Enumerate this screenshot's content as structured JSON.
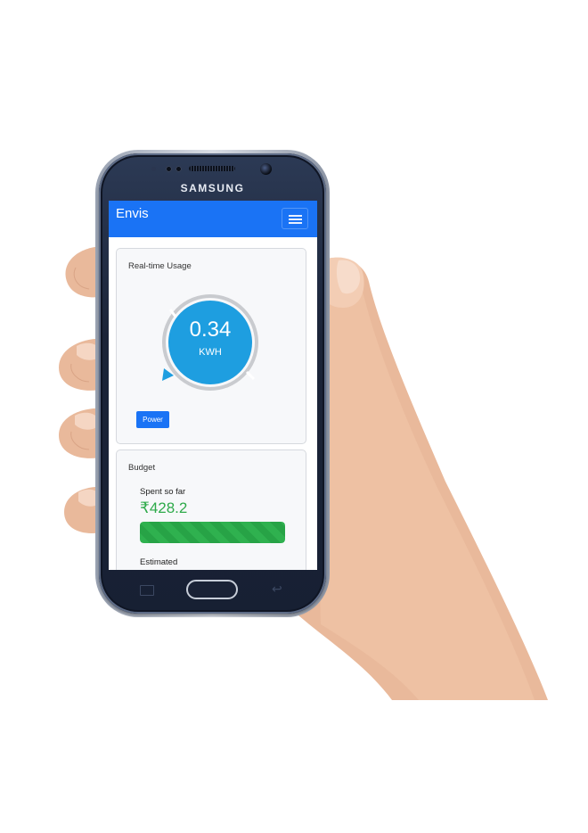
{
  "device": {
    "brand": "SAMSUNG"
  },
  "app": {
    "title": "Envis",
    "menu_icon": "hamburger-menu-icon",
    "accent_color": "#1a73f5"
  },
  "realtime_card": {
    "title": "Real-time Usage",
    "gauge_value": "0.34",
    "gauge_unit": "KWH",
    "gauge_color": "#1e9ee0",
    "power_button_label": "Power"
  },
  "budget_card": {
    "title": "Budget",
    "spent_label": "Spent so far",
    "spent_value": "₹428.2",
    "spent_color": "#2eaa4a",
    "progress_fraction": 1.0,
    "estimated_label": "Estimated"
  }
}
